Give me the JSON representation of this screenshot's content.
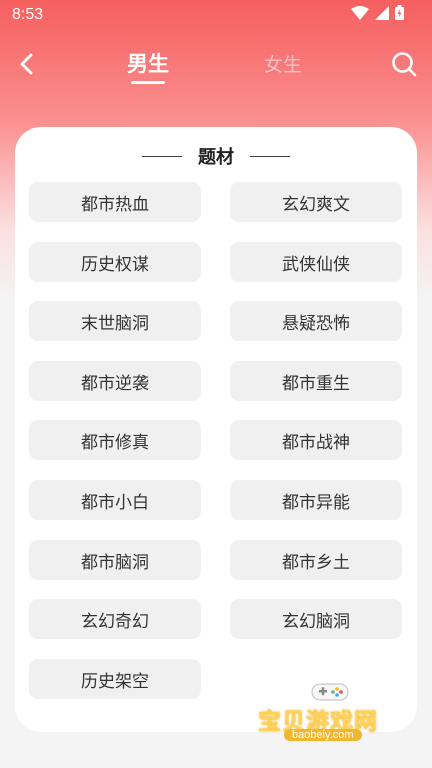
{
  "status_bar": {
    "time": "8:53"
  },
  "nav": {
    "tab_male": "男生",
    "tab_female": "女生"
  },
  "card": {
    "title": "题材",
    "tags": [
      "都市热血",
      "玄幻爽文",
      "历史权谋",
      "武侠仙侠",
      "末世脑洞",
      "悬疑恐怖",
      "都市逆袭",
      "都市重生",
      "都市修真",
      "都市战神",
      "都市小白",
      "都市异能",
      "都市脑洞",
      "都市乡土",
      "玄幻奇幻",
      "玄幻脑洞",
      "历史架空"
    ]
  },
  "watermark": {
    "text": "宝贝游戏网",
    "url": "baobeiy.com"
  },
  "colors": {
    "accent": "#f65f5f",
    "tag_bg": "#f0f0f0"
  }
}
